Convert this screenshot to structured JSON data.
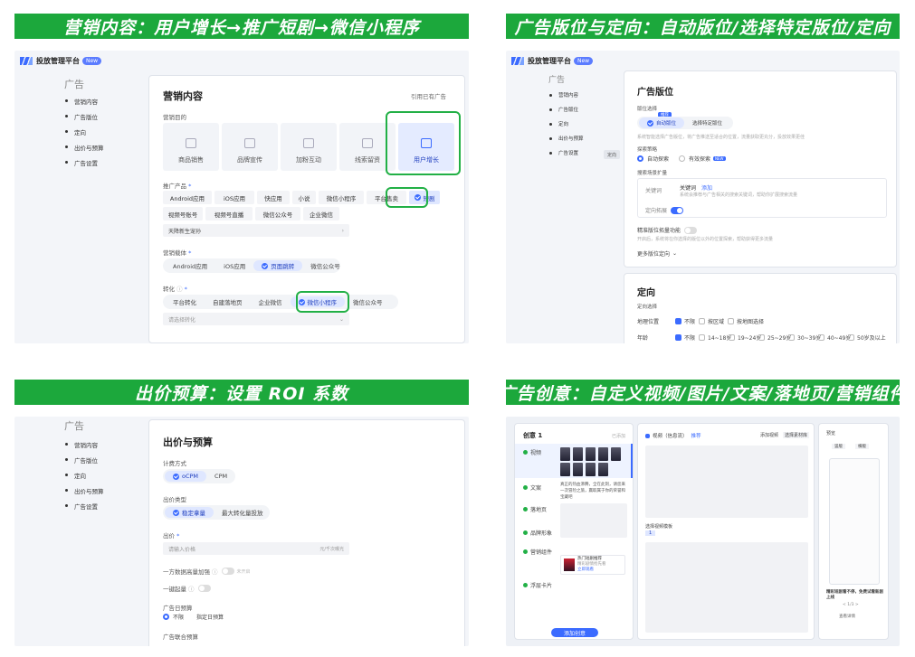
{
  "banners": {
    "q1": "营销内容：用户增长→推广短剧→微信小程序",
    "q2": "广告版位与定向：自动版位/选择特定版位/定向",
    "q3": "出价预算：设置 ROI 系数",
    "q4": "广告创意：自定义视频/图片/文案/落地页/营销组件"
  },
  "app": {
    "title": "投放管理平台",
    "badge": "New"
  },
  "sidebar": {
    "heading": "广告",
    "items": [
      "营销内容",
      "广告版位",
      "定向",
      "出价与预算",
      "广告设置"
    ]
  },
  "q1": {
    "title": "营销内容",
    "link": "引用已有广告",
    "goal_label": "营销目的",
    "goals": [
      "商品销售",
      "品牌宣传",
      "加粉互动",
      "线索留资",
      "用户增长"
    ],
    "product_label": "推广产品",
    "products_row1": [
      "Android应用",
      "iOS应用",
      "快应用",
      "小说",
      "微信小程序",
      "平台售卖",
      "短剧"
    ],
    "products_row2": [
      "视频号账号",
      "视频号直播",
      "微信公众号",
      "企业微信"
    ],
    "product_select": "天降新生宠孙",
    "carrier_label": "营销载体",
    "carriers": [
      "Android应用",
      "iOS应用",
      "页面跳转",
      "微信公众号"
    ],
    "conv_label": "转化",
    "convs": [
      "平台转化",
      "自建落地页",
      "企业微信",
      "微信小程序",
      "微信公众号"
    ],
    "conv_select": "请选择转化"
  },
  "q2": {
    "title": "广告版位",
    "place_label": "版位选择",
    "place_badge": "推荐",
    "place_opts": [
      "自动版位",
      "选择特定版位"
    ],
    "place_hint": "系统智能选择广告版位，将广告推送至适合的位置，流量获取更充分，投放效果更佳",
    "exp_label": "探索策略",
    "exp_opts": [
      "自动探索",
      "有效探索"
    ],
    "exp_badge": "NEW",
    "expand_label": "搜索场景扩量",
    "kw_label": "关键词",
    "kw_value": "关键词",
    "kw_link": "添加",
    "kw_hint": "系统会推荐与广告相关的搜索关键词，帮助你扩展搜索流量",
    "smart_label": "定向拓展",
    "region_label": "精准版位拓量功能",
    "region_hint": "开启后，系统将在你选择的版位以外的位置探索，帮助获得更多流量",
    "more_label": "更多版位定向",
    "target_title": "定向",
    "target_sub": "定向选择",
    "geo_label": "地理位置",
    "geo_opts": [
      "不限",
      "按区域",
      "按地图选择"
    ],
    "age_label": "年龄",
    "age_opts": [
      "不限",
      "14~18岁",
      "19~24岁",
      "25~29岁",
      "30~39岁",
      "40~49岁",
      "50岁及以上"
    ],
    "sidebtn": "定向"
  },
  "q3": {
    "title": "出价与预算",
    "bill_label": "计费方式",
    "bill_opts": [
      "oCPM",
      "CPM"
    ],
    "bid_type_label": "出价类型",
    "bid_type_opts": [
      "稳定拿量",
      "最大转化量投放"
    ],
    "bid_label": "出价",
    "bid_placeholder": "请输入价格",
    "bid_unit": "元/千次曝光",
    "coef_label": "一方数据高量加强",
    "coef_hint": "未开启",
    "deep_label": "一键起量",
    "budget_label": "广告日预算",
    "budget_opts": [
      "不限",
      "指定日预算"
    ],
    "total_label": "广告联合预算"
  },
  "q4": {
    "card_title": "创意 1",
    "card_right": "已添加",
    "rows": [
      "视频",
      "文案",
      "落地页",
      "品牌形象",
      "营销组件",
      "浮层卡片"
    ],
    "text_sample": "真正的热血沸腾，全在此刻，请您来一次冒险之旅，赢取属于你的荣誉和宝藏吧",
    "promo_title": "热门短剧推荐",
    "promo_sub": "精彩剧情抢先看",
    "promo_btn": "立即观看",
    "card_btn": "添加创意",
    "mid_title": "视频（信息流）",
    "mid_badge": "推荐",
    "mid_right1": "添加视频",
    "mid_right2": "选择素材库",
    "mid_sub": "选择视频模板",
    "mid_tab": "1",
    "preview_title": "预览",
    "preview_tabs": [
      "竖版",
      "横版"
    ],
    "preview_caption": "精彩短剧看不停，免费试看新剧上线",
    "preview_pager": "< 1/3 >",
    "preview_btn": "查看详情"
  }
}
